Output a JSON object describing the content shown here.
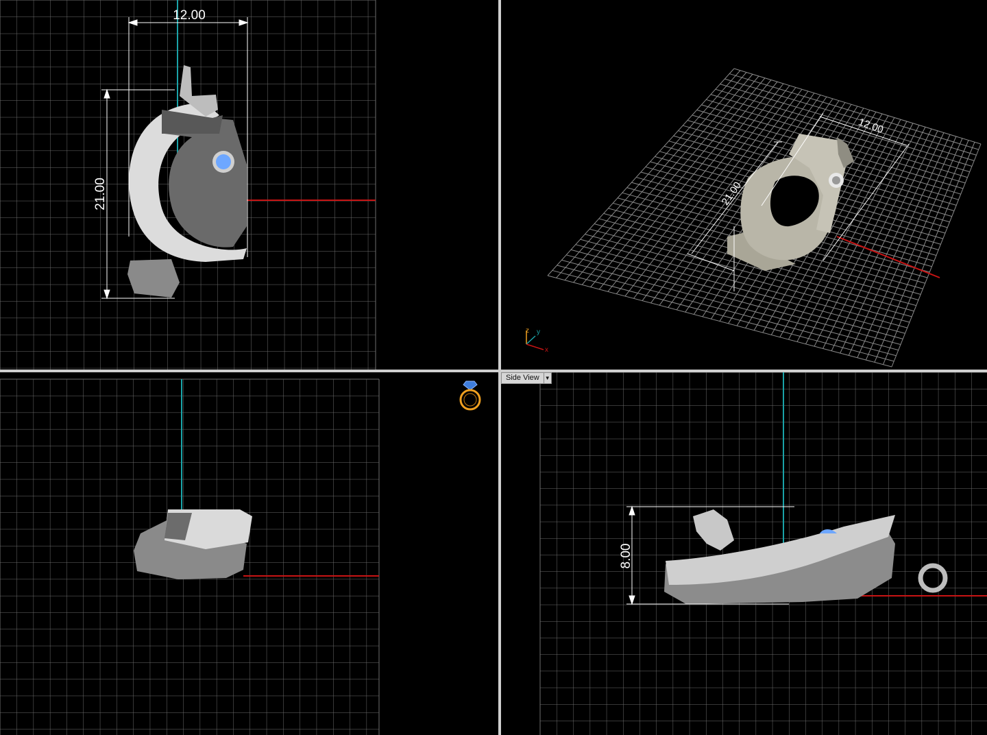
{
  "viewports": {
    "top": {
      "width_label": "12.00",
      "height_label": "21.00"
    },
    "perspective": {
      "width_label": "12.00",
      "height_label": "21.00",
      "axis_labels": {
        "z": "z",
        "y": "y",
        "x": "x"
      }
    },
    "front": {},
    "side": {
      "view_menu_label": "Side View",
      "height_label": "8.00"
    }
  },
  "colors": {
    "grid": "#7a7a7a",
    "axis_red": "#c81414",
    "axis_teal": "#1aa3a8",
    "gem": "#6ea7ff",
    "metal_light": "#d8d8d8",
    "metal_dark": "#6a6a6a",
    "metal_tan": "#b9b6a8",
    "ring_icon": "#f0a020",
    "ring_gem": "#3e7ddc"
  }
}
